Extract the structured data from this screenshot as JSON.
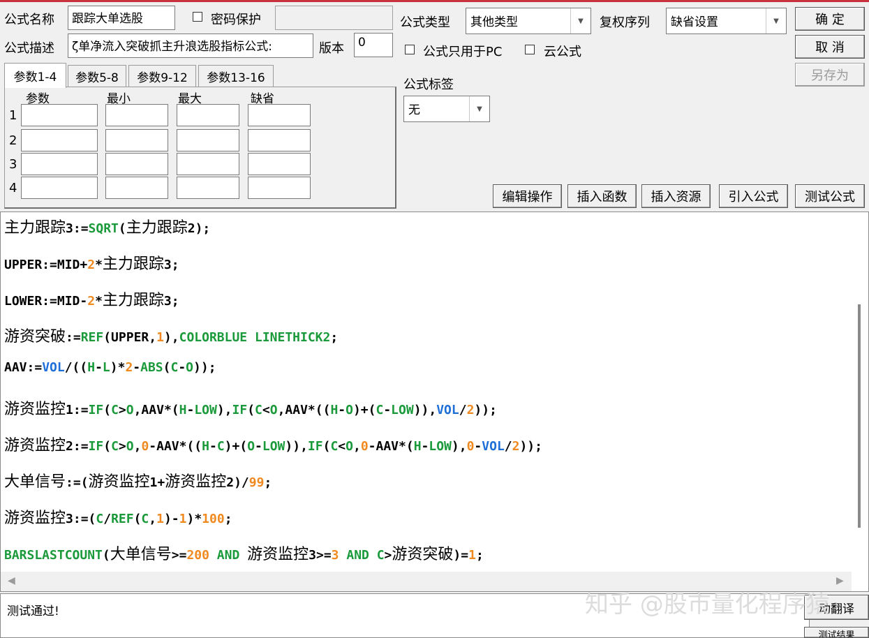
{
  "header": {
    "name_label": "公式名称",
    "name_value": "跟踪大单选股",
    "password_label": "密码保护",
    "password_value": "",
    "desc_label": "公式描述",
    "desc_value": "ζ单净流入突破抓主升浪选股指标公式:",
    "version_label": "版本",
    "version_value": "0",
    "type_label": "公式类型",
    "type_value": "其他类型",
    "rights_label": "复权序列",
    "rights_value": "缺省设置",
    "pc_only_label": "公式只用于PC",
    "cloud_label": "云公式",
    "tags_label": "公式标签",
    "tags_value": "无"
  },
  "buttons": {
    "ok": "确 定",
    "cancel": "取 消",
    "save_as": "另存为",
    "edit_ops": "编辑操作",
    "insert_func": "插入函数",
    "insert_res": "插入资源",
    "import_formula": "引入公式",
    "test_formula": "测试公式",
    "translate": "动翻译",
    "test_result": "测试结果"
  },
  "params": {
    "tabs": [
      "参数1-4",
      "参数5-8",
      "参数9-12",
      "参数13-16"
    ],
    "columns": [
      "参数",
      "最小",
      "最大",
      "缺省"
    ],
    "rows": [
      "1",
      "2",
      "3",
      "4"
    ]
  },
  "code": {
    "line1": {
      "a": "主力跟踪",
      "b": "3:=",
      "c": "SQRT",
      "d": "(",
      "e": "主力跟踪",
      "f": "2);"
    },
    "line2": {
      "a": "UPPER:=MID+",
      "b": "2",
      "c": "*",
      "d": "主力跟踪",
      "e": "3;"
    },
    "line3": {
      "a": "LOWER:=MID-",
      "b": "2",
      "c": "*",
      "d": "主力跟踪",
      "e": "3;"
    },
    "line4": {
      "a": "游资突破",
      "b": ":=",
      "c": "REF",
      "d": "(UPPER,",
      "e": "1",
      "f": "),",
      "g": "COLORBLUE LINETHICK2",
      "h": ";"
    },
    "line5": {
      "a": "AAV:=",
      "b": "VOL",
      "c": "/((",
      "d": "H",
      "e": "-",
      "f": "L",
      "g": ")*",
      "h": "2",
      "i": "-",
      "j": "ABS",
      "k": "(",
      "l": "C",
      "m": "-",
      "n": "O",
      "o": "));"
    },
    "line6": {
      "a": "游资监控",
      "b": "1:=",
      "c": "IF",
      "d": "(",
      "e": "C",
      "f": ">",
      "g": "O",
      "h": ",AAV*(",
      "i": "H",
      "j": "-",
      "k": "LOW",
      "l": "),",
      "m": "IF",
      "n": "(",
      "o": "C",
      "p": "<",
      "q": "O",
      "r": ",AAV*((",
      "s": "H",
      "t": "-",
      "u": "O",
      "v": ")+(",
      "w": "C",
      "x": "-",
      "y": "LOW",
      "z": ")),",
      "aa": "VOL",
      "ab": "/",
      "ac": "2",
      "ad": "));"
    },
    "line7": {
      "a": "游资监控",
      "b": "2:=",
      "c": "IF",
      "d": "(",
      "e": "C",
      "f": ">",
      "g": "O",
      "h": ",",
      "i": "0",
      "j": "-AAV*((",
      "k": "H",
      "l": "-",
      "m": "C",
      "n": ")+(",
      "o": "O",
      "p": "-",
      "q": "LOW",
      "r": ")),",
      "s": "IF",
      "t": "(",
      "u": "C",
      "v": "<",
      "w": "O",
      "x": ",",
      "y": "0",
      "z": "-AAV*(",
      "aa": "H",
      "ab": "-",
      "ac": "LOW",
      "ad": "),",
      "ae": "0",
      "af": "-",
      "ag": "VOL",
      "ah": "/",
      "ai": "2",
      "aj": "));"
    },
    "line8": {
      "a": "大单信号",
      "b": ":=(",
      "c": "游资监控",
      "d": "1+",
      "e": "游资监控",
      "f": "2)/",
      "g": "99",
      "h": ";"
    },
    "line9": {
      "a": "游资监控",
      "b": "3:=(",
      "c": "C",
      "d": "/",
      "e": "REF",
      "f": "(",
      "g": "C",
      "h": ",",
      "i": "1",
      "j": ")-",
      "k": "1",
      "l": ")*",
      "m": "100",
      "n": ";"
    },
    "line10": {
      "a": "BARSLASTCOUNT",
      "b": "(",
      "c": "大单信号",
      "d": ">=",
      "e": "200",
      "f": " AND ",
      "g": "游资监控",
      "h": "3>=",
      "i": "3",
      "j": " AND ",
      "k": "C",
      "l": ">",
      "m": "游资突破",
      "n": ")=",
      "o": "1",
      "p": ";"
    }
  },
  "status": {
    "message": "测试通过!"
  },
  "watermark": "知乎 @股市量化程序猿",
  "colors": {
    "keyword_green": "#1a9a3a",
    "number_orange": "#f08a20",
    "variable_blue": "#1f6fd8"
  }
}
